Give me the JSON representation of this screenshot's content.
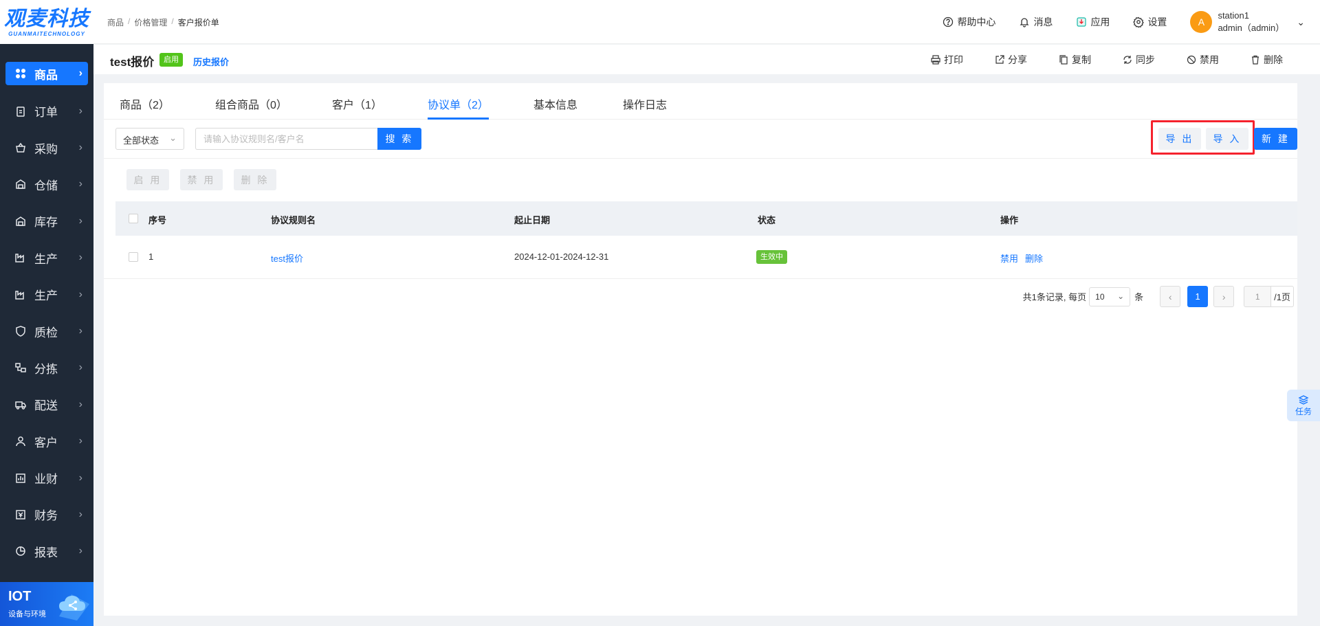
{
  "logo": {
    "main": "观麦科技",
    "sub": "GUANMAITECHNOLOGY"
  },
  "sidebar": {
    "items": [
      {
        "label": "商品",
        "icon": "grid-icon",
        "active": true
      },
      {
        "label": "订单",
        "icon": "clipboard-icon"
      },
      {
        "label": "采购",
        "icon": "basket-icon"
      },
      {
        "label": "仓储",
        "icon": "warehouse-icon"
      },
      {
        "label": "库存",
        "icon": "warehouse-icon"
      },
      {
        "label": "生产",
        "icon": "factory-icon"
      },
      {
        "label": "生产",
        "icon": "factory-icon"
      },
      {
        "label": "质检",
        "icon": "shield-icon"
      },
      {
        "label": "分拣",
        "icon": "sort-icon"
      },
      {
        "label": "配送",
        "icon": "truck-icon"
      },
      {
        "label": "客户",
        "icon": "user-icon"
      },
      {
        "label": "业财",
        "icon": "bar-chart-icon"
      },
      {
        "label": "财务",
        "icon": "finance-icon"
      },
      {
        "label": "报表",
        "icon": "pie-icon"
      }
    ],
    "iot": {
      "title": "IOT",
      "subtitle": "设备与环境"
    }
  },
  "breadcrumb": [
    "商品",
    "价格管理",
    "客户报价单"
  ],
  "header": {
    "help": "帮助中心",
    "messages": "消息",
    "apps": "应用",
    "settings": "设置",
    "user": {
      "avatar": "A",
      "name": "station1",
      "account": "admin（admin）"
    }
  },
  "titlebar": {
    "title": "test报价",
    "badge": "启用",
    "history_link": "历史报价",
    "actions": [
      "打印",
      "分享",
      "复制",
      "同步",
      "禁用",
      "删除"
    ]
  },
  "tabs": [
    "商品（2）",
    "组合商品（0）",
    "客户（1）",
    "协议单（2）",
    "基本信息",
    "操作日志"
  ],
  "toolbar": {
    "status_filter": "全部状态",
    "search_placeholder": "请输入协议规则名/客户名",
    "search_button": "搜 索",
    "export_button": "导 出",
    "import_button": "导 入",
    "new_button": "新 建"
  },
  "batch": {
    "enable": "启 用",
    "disable": "禁 用",
    "delete": "删 除"
  },
  "table": {
    "columns": [
      "序号",
      "协议规则名",
      "起止日期",
      "状态",
      "操作"
    ],
    "rows": [
      {
        "index": "1",
        "name": "test报价",
        "dates": "2024-12-01-2024-12-31",
        "status": "生效中",
        "action_disable": "禁用",
        "action_delete": "删除"
      }
    ]
  },
  "pagination": {
    "summary": "共1条记录, 每页",
    "page_size": "10",
    "unit": "条",
    "current": "1",
    "jump_value": "1",
    "total_pages": "/1页"
  },
  "task_float": "任务",
  "colors": {
    "primary": "#1677ff",
    "sidebar": "#1f2937",
    "success": "#52c41a",
    "highlight": "#f5222d"
  }
}
